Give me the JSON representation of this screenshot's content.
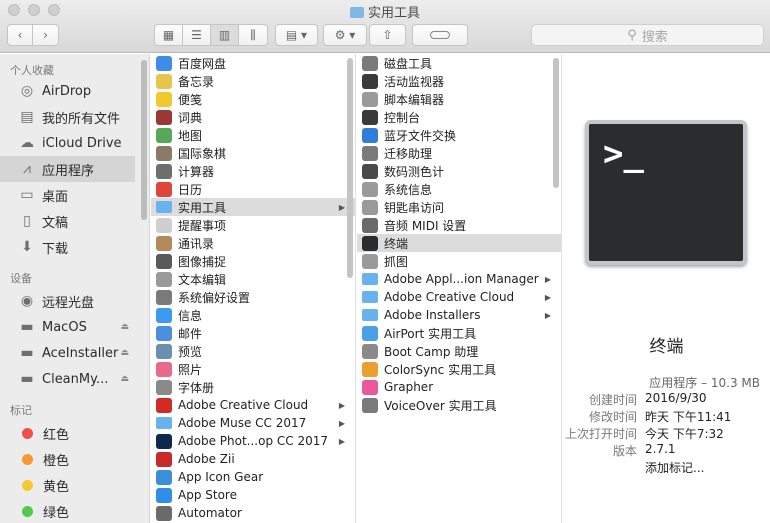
{
  "window": {
    "title": "实用工具"
  },
  "toolbar": {
    "search_placeholder": "搜索"
  },
  "sidebar": {
    "favorites_header": "个人收藏",
    "favorites": [
      {
        "label": "AirDrop",
        "icon": "airdrop-icon"
      },
      {
        "label": "我的所有文件",
        "icon": "all-files-icon"
      },
      {
        "label": "iCloud Drive",
        "icon": "cloud-icon"
      },
      {
        "label": "应用程序",
        "icon": "applications-icon",
        "selected": true
      },
      {
        "label": "桌面",
        "icon": "desktop-icon"
      },
      {
        "label": "文稿",
        "icon": "document-icon"
      },
      {
        "label": "下载",
        "icon": "download-icon"
      }
    ],
    "devices_header": "设备",
    "devices": [
      {
        "label": "远程光盘",
        "icon": "disc-icon"
      },
      {
        "label": "MacOS",
        "icon": "disk-icon",
        "eject": true
      },
      {
        "label": "AceInstaller",
        "icon": "disk-icon",
        "eject": true
      },
      {
        "label": "CleanMy...",
        "icon": "disk-icon",
        "eject": true
      }
    ],
    "tags_header": "标记",
    "tags": [
      {
        "label": "红色",
        "color": "#f0504a"
      },
      {
        "label": "橙色",
        "color": "#f59a31"
      },
      {
        "label": "黄色",
        "color": "#f5c933"
      },
      {
        "label": "绿色",
        "color": "#58c84a"
      }
    ]
  },
  "column1": [
    {
      "label": "百度网盘",
      "color": "#3d8de6"
    },
    {
      "label": "备忘录",
      "color": "#e8c44c"
    },
    {
      "label": "便笺",
      "color": "#f0c92e"
    },
    {
      "label": "词典",
      "color": "#9b3a34"
    },
    {
      "label": "地图",
      "color": "#58a85a"
    },
    {
      "label": "国际象棋",
      "color": "#8a7a66"
    },
    {
      "label": "计算器",
      "color": "#6e6e6e"
    },
    {
      "label": "日历",
      "color": "#e0453a"
    },
    {
      "label": "实用工具",
      "folder": true,
      "arrow": true,
      "selected": true
    },
    {
      "label": "提醒事项",
      "color": "#cfcfcf"
    },
    {
      "label": "通讯录",
      "color": "#b58a5a"
    },
    {
      "label": "图像捕捉",
      "color": "#5a5a5a"
    },
    {
      "label": "文本编辑",
      "color": "#9a9a9a"
    },
    {
      "label": "系统偏好设置",
      "color": "#7a7a7a"
    },
    {
      "label": "信息",
      "color": "#3b9bf0"
    },
    {
      "label": "邮件",
      "color": "#4a8fe0"
    },
    {
      "label": "预览",
      "color": "#6b8fb0"
    },
    {
      "label": "照片",
      "color": "#e86a8a"
    },
    {
      "label": "字体册",
      "color": "#8a8a8a"
    },
    {
      "label": "Adobe Creative Cloud",
      "color": "#d22a24",
      "arrow": true
    },
    {
      "label": "Adobe Muse CC 2017",
      "folder": true,
      "arrow": true
    },
    {
      "label": "Adobe Phot...op CC 2017",
      "color": "#0d2a4a",
      "arrow": true
    },
    {
      "label": "Adobe Zii",
      "color": "#c62a2a"
    },
    {
      "label": "App Icon Gear",
      "color": "#3a8fd8"
    },
    {
      "label": "App Store",
      "color": "#2f8fe8"
    },
    {
      "label": "Automator",
      "color": "#6a6a6a"
    }
  ],
  "column2": [
    {
      "label": "磁盘工具",
      "color": "#7a7a7a"
    },
    {
      "label": "活动监视器",
      "color": "#3a3a3a"
    },
    {
      "label": "脚本编辑器",
      "color": "#9a9a9a"
    },
    {
      "label": "控制台",
      "color": "#3a3a3a"
    },
    {
      "label": "蓝牙文件交换",
      "color": "#2f7fd8"
    },
    {
      "label": "迁移助理",
      "color": "#7a7a7a"
    },
    {
      "label": "数码测色计",
      "color": "#4a4a4a"
    },
    {
      "label": "系统信息",
      "color": "#9a9a9a"
    },
    {
      "label": "钥匙串访问",
      "color": "#9a9a9a"
    },
    {
      "label": "音频 MIDI 设置",
      "color": "#6a6a6a"
    },
    {
      "label": "终端",
      "color": "#2a2c2e",
      "selected": true
    },
    {
      "label": "抓图",
      "color": "#9a9a9a"
    },
    {
      "label": "Adobe Appl...ion Manager",
      "folder": true,
      "arrow": true
    },
    {
      "label": "Adobe Creative Cloud",
      "folder": true,
      "arrow": true
    },
    {
      "label": "Adobe Installers",
      "folder": true,
      "arrow": true
    },
    {
      "label": "AirPort 实用工具",
      "color": "#4aa0e8"
    },
    {
      "label": "Boot Camp 助理",
      "color": "#8a8a8a"
    },
    {
      "label": "ColorSync 实用工具",
      "color": "#e8a030"
    },
    {
      "label": "Grapher",
      "color": "#e85a9a"
    },
    {
      "label": "VoiceOver 实用工具",
      "color": "#7a7a7a"
    }
  ],
  "preview": {
    "prompt": ">_",
    "name": "终端",
    "kind": "应用程序 – 10.3 MB",
    "info": [
      {
        "key": "创建时间",
        "value": "2016/9/30"
      },
      {
        "key": "修改时间",
        "value": "昨天 下午11:41"
      },
      {
        "key": "上次打开时间",
        "value": "今天 下午7:32"
      },
      {
        "key": "版本",
        "value": "2.7.1"
      }
    ],
    "add_tags": "添加标记..."
  }
}
